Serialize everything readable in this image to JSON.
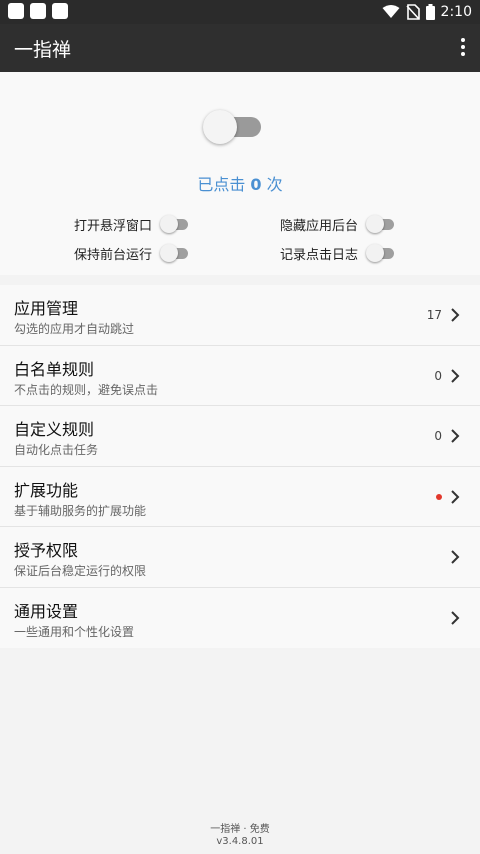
{
  "status_bar": {
    "time": "2:10"
  },
  "app_bar": {
    "title": "一指禅"
  },
  "hero": {
    "count_prefix": "已点击",
    "count_value": "0",
    "count_suffix": "次",
    "main_toggle_on": false
  },
  "options": {
    "floating_window": "打开悬浮窗口",
    "hide_from_recents": "隐藏应用后台",
    "keep_foreground": "保持前台运行",
    "log_clicks": "记录点击日志"
  },
  "menu": [
    {
      "title": "应用管理",
      "subtitle": "勾选的应用才自动跳过",
      "count": "17",
      "dot": false
    },
    {
      "title": "白名单规则",
      "subtitle": "不点击的规则，避免误点击",
      "count": "0",
      "dot": false
    },
    {
      "title": "自定义规则",
      "subtitle": "自动化点击任务",
      "count": "0",
      "dot": false
    },
    {
      "title": "扩展功能",
      "subtitle": "基于辅助服务的扩展功能",
      "count": "",
      "dot": true
    },
    {
      "title": "授予权限",
      "subtitle": "保证后台稳定运行的权限",
      "count": "",
      "dot": false
    },
    {
      "title": "通用设置",
      "subtitle": "一些通用和个性化设置",
      "count": "",
      "dot": false
    }
  ],
  "footer": {
    "line1": "一指禅 · 免费",
    "line2": "v3.4.8.01"
  },
  "colors": {
    "accent": "#4a90d2",
    "badge_dot": "#e2382c",
    "app_bar": "#2f2f2f"
  }
}
